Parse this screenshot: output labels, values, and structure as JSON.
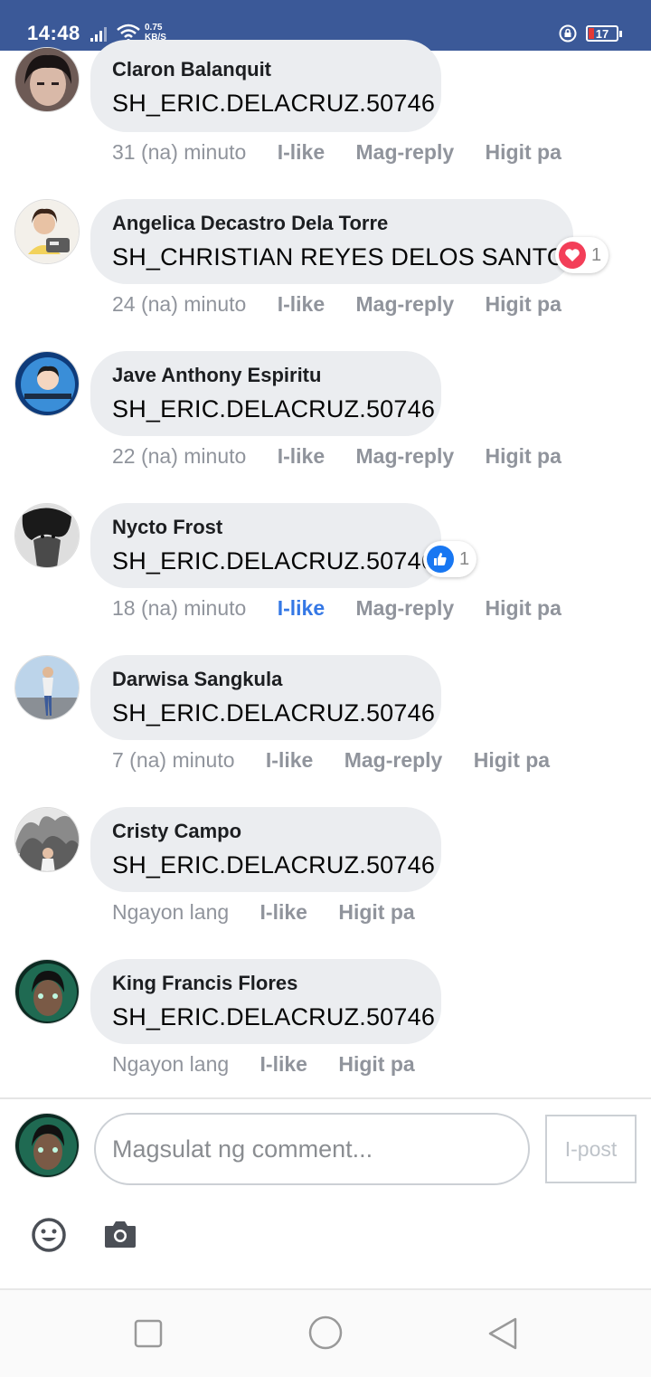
{
  "status_bar": {
    "time": "14:48",
    "network_speed_value": "0.75",
    "network_speed_unit": "KB/S",
    "battery_level": "17",
    "background_color": "#3b5998"
  },
  "comments": [
    {
      "author": "Claron Balanquit",
      "text": "SH_ERIC.DELACRUZ.50746",
      "time": "31 (na) minuto",
      "like_label": "I-like",
      "reply_label": "Mag-reply",
      "more_label": "Higit pa",
      "liked": false
    },
    {
      "author": "Angelica Decastro Dela Torre",
      "text": "SH_CHRISTIAN REYES DELOS SANTOS",
      "time": "24 (na) minuto",
      "like_label": "I-like",
      "reply_label": "Mag-reply",
      "more_label": "Higit pa",
      "liked": false,
      "reaction": {
        "icon": "heart-icon",
        "count": "1",
        "color": "#f33e58"
      }
    },
    {
      "author": "Jave Anthony Espiritu",
      "text": "SH_ERIC.DELACRUZ.50746",
      "time": "22 (na) minuto",
      "like_label": "I-like",
      "reply_label": "Mag-reply",
      "more_label": "Higit pa",
      "liked": false
    },
    {
      "author": "Nycto Frost",
      "text": "SH_ERIC.DELACRUZ.50746",
      "time": "18 (na) minuto",
      "like_label": "I-like",
      "reply_label": "Mag-reply",
      "more_label": "Higit pa",
      "liked": true,
      "reaction": {
        "icon": "thumbs-up-icon",
        "count": "1",
        "color": "#1877f2"
      }
    },
    {
      "author": "Darwisa Sangkula",
      "text": "SH_ERIC.DELACRUZ.50746",
      "time": "7 (na) minuto",
      "like_label": "I-like",
      "reply_label": "Mag-reply",
      "more_label": "Higit pa",
      "liked": false
    },
    {
      "author": "Cristy Campo",
      "text": "SH_ERIC.DELACRUZ.50746",
      "time": "Ngayon lang",
      "like_label": "I-like",
      "more_label": "Higit pa",
      "liked": false
    },
    {
      "author": "King Francis Flores",
      "text": "SH_ERIC.DELACRUZ.50746",
      "time": "Ngayon lang",
      "like_label": "I-like",
      "more_label": "Higit pa",
      "liked": false
    }
  ],
  "composer": {
    "placeholder": "Magsulat ng comment...",
    "post_label": "I-post",
    "emoji_icon": "smiley-icon",
    "camera_icon": "camera-icon"
  },
  "navbar": {
    "recents_icon": "square-icon",
    "home_icon": "circle-icon",
    "back_icon": "triangle-back-icon"
  },
  "colors": {
    "liked_action": "#3578e5",
    "bubble": "#ebedf0",
    "action_text": "#90949c"
  }
}
